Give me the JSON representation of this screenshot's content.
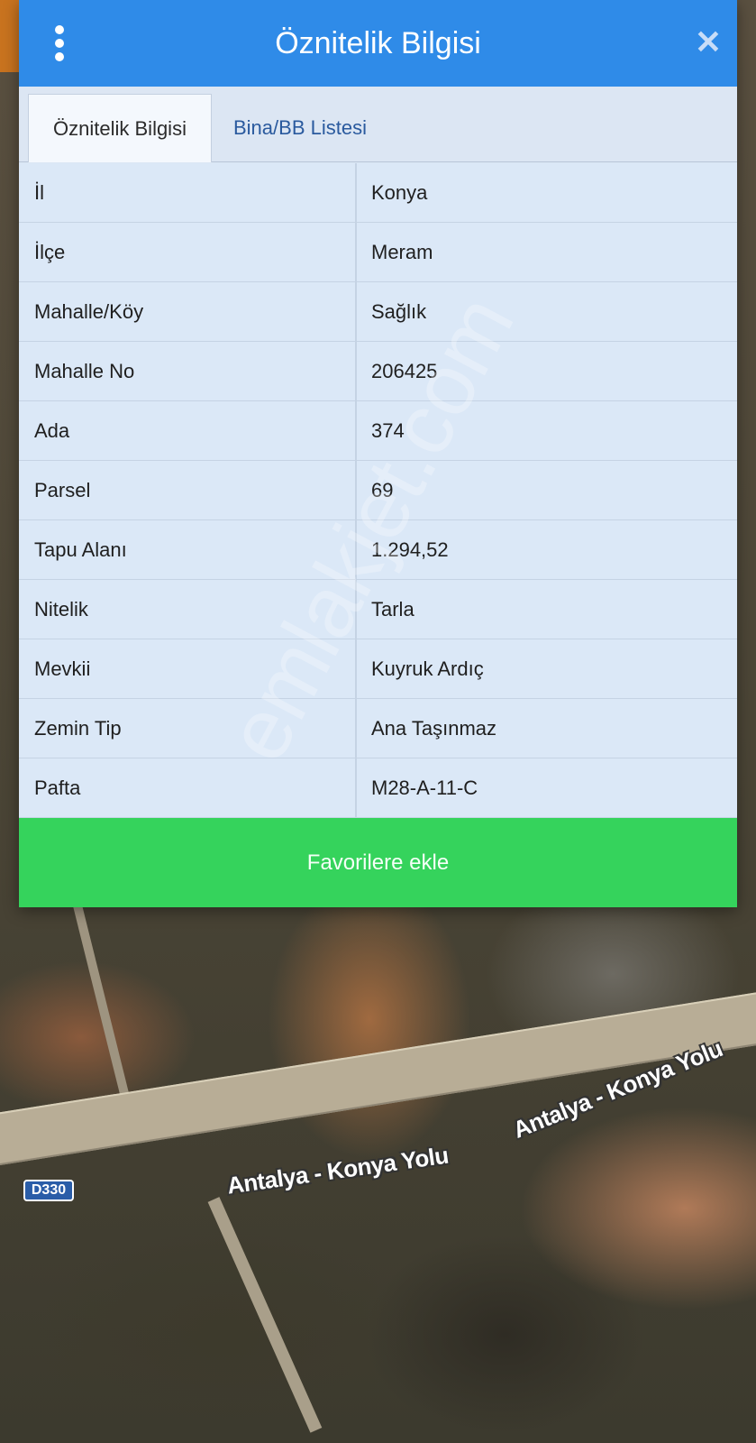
{
  "dialog": {
    "title": "Öznitelik Bilgisi",
    "close_icon": "close-icon",
    "menu_icon": "more-vertical-icon"
  },
  "tabs": [
    {
      "label": "Öznitelik Bilgisi",
      "active": true
    },
    {
      "label": "Bina/BB Listesi",
      "active": false
    }
  ],
  "attributes": [
    {
      "key": "İl",
      "value": "Konya"
    },
    {
      "key": "İlçe",
      "value": "Meram"
    },
    {
      "key": "Mahalle/Köy",
      "value": "Sağlık"
    },
    {
      "key": "Mahalle No",
      "value": "206425"
    },
    {
      "key": "Ada",
      "value": "374"
    },
    {
      "key": "Parsel",
      "value": "69"
    },
    {
      "key": "Tapu Alanı",
      "value": "1.294,52"
    },
    {
      "key": "Nitelik",
      "value": "Tarla"
    },
    {
      "key": "Mevkii",
      "value": "Kuyruk Ardıç"
    },
    {
      "key": "Zemin Tip",
      "value": "Ana Taşınmaz"
    },
    {
      "key": "Pafta",
      "value": "M28-A-11-C"
    }
  ],
  "favorite_button": "Favorilere ekle",
  "map": {
    "road_label_1": "Antalya - Konya Yolu",
    "road_label_2": "Antalya - Konya Yolu",
    "route_badge": "D330"
  },
  "watermark": "emlakjet.com",
  "colors": {
    "header": "#2f8be8",
    "button": "#35d35c",
    "table_bg": "#dbe8f7"
  }
}
